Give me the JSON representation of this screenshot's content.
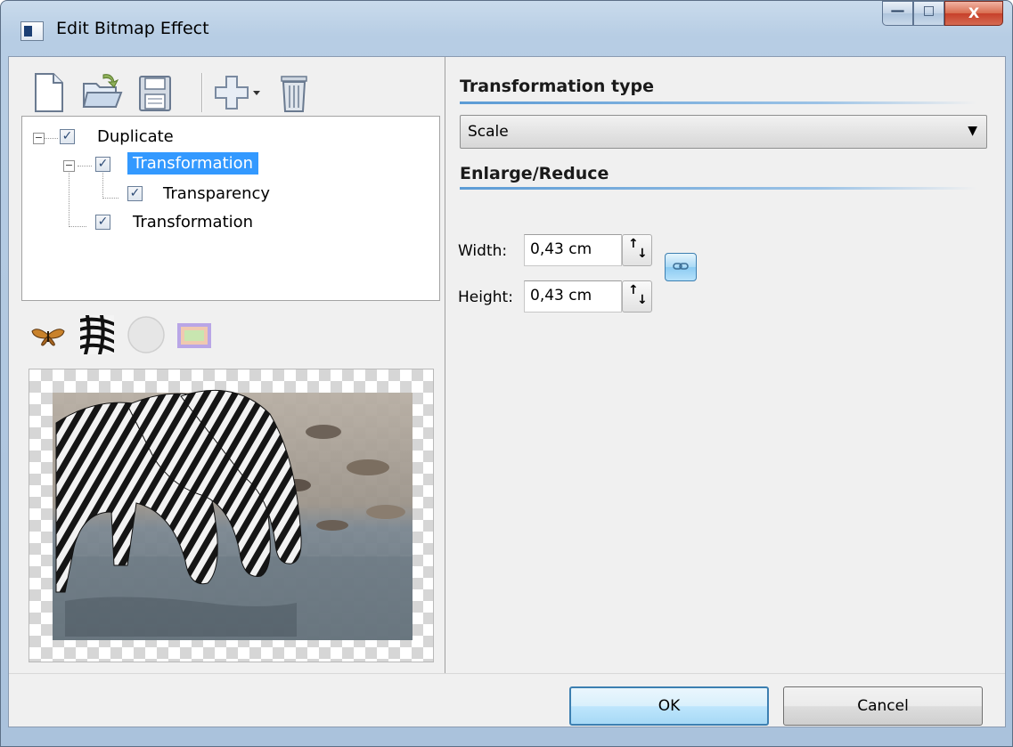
{
  "window": {
    "title": "Edit Bitmap Effect",
    "caption_buttons": {
      "minimize": "—",
      "maximize": "□",
      "close": "X"
    }
  },
  "toolbar": {
    "buttons": [
      {
        "name": "new",
        "icon": "new-document-icon"
      },
      {
        "name": "open",
        "icon": "open-folder-icon"
      },
      {
        "name": "save",
        "icon": "save-floppy-icon"
      },
      {
        "name": "add",
        "icon": "add-plus-dropdown-icon"
      },
      {
        "name": "delete",
        "icon": "trash-icon"
      }
    ]
  },
  "tree": {
    "items": [
      {
        "label": "Duplicate",
        "checked": true,
        "expanded": true,
        "selected": false
      },
      {
        "label": "Transformation",
        "checked": true,
        "expanded": true,
        "selected": true
      },
      {
        "label": "Transparency",
        "checked": true,
        "selected": false
      },
      {
        "label": "Transformation",
        "checked": true,
        "selected": false
      }
    ],
    "check_glyph": "✓",
    "expander_glyph": "−"
  },
  "swatches": [
    "butterfly-icon",
    "zebra-stripes-icon",
    "circle-icon",
    "frame-icon"
  ],
  "properties": {
    "transformation_type_heading": "Transformation type",
    "transformation_type_value": "Scale",
    "combo_arrow": "▼",
    "enlarge_reduce_heading": "Enlarge/Reduce",
    "width_label": "Width:",
    "width_value": "0,43 cm",
    "height_label": "Height:",
    "height_value": "0,43 cm",
    "spin_up": "↑",
    "spin_down": "↓"
  },
  "footer": {
    "ok_label": "OK",
    "cancel_label": "Cancel"
  }
}
